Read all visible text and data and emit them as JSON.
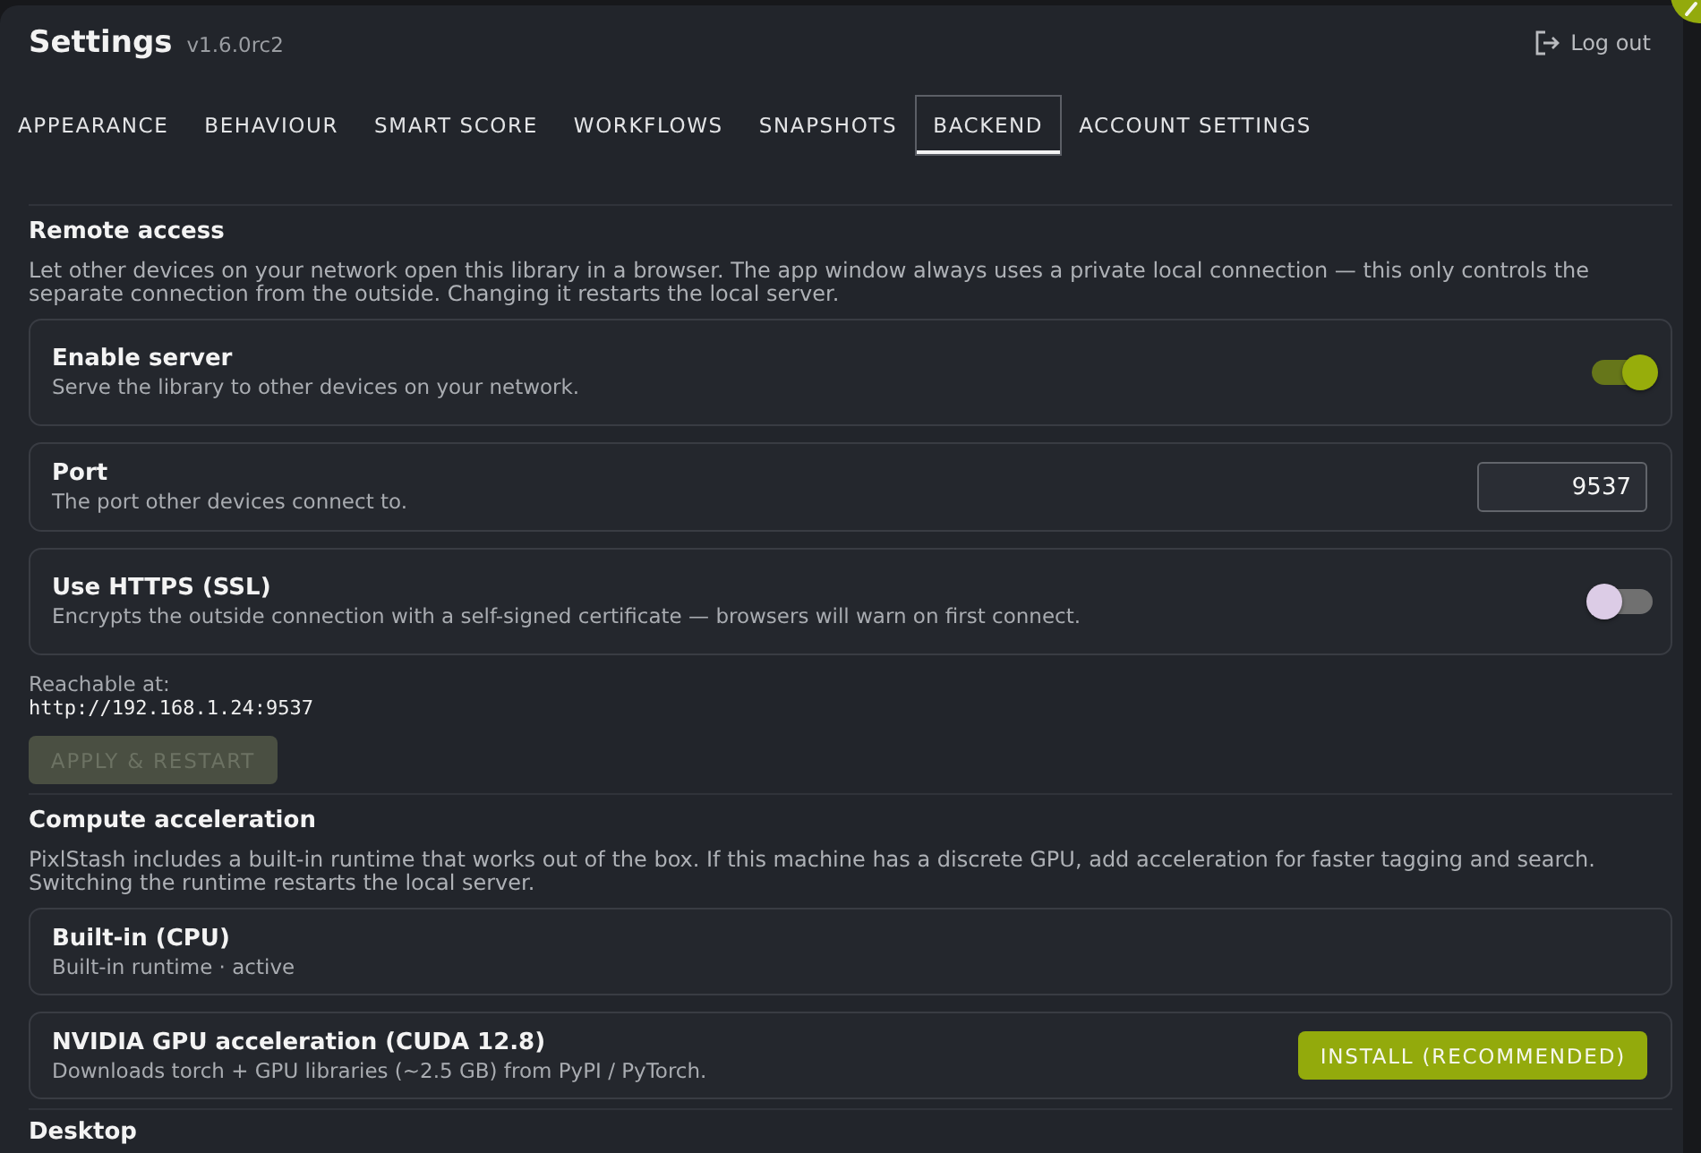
{
  "header": {
    "title": "Settings",
    "version": "v1.6.0rc2",
    "logout": "Log out"
  },
  "tabs": [
    {
      "label": "APPEARANCE",
      "selected": false
    },
    {
      "label": "BEHAVIOUR",
      "selected": false
    },
    {
      "label": "SMART SCORE",
      "selected": false
    },
    {
      "label": "WORKFLOWS",
      "selected": false
    },
    {
      "label": "SNAPSHOTS",
      "selected": false
    },
    {
      "label": "BACKEND",
      "selected": true
    },
    {
      "label": "ACCOUNT SETTINGS",
      "selected": false
    }
  ],
  "sections": [
    {
      "title": "Remote access",
      "description": "Let other devices on your network open this library in a browser. The app window always uses a private local connection — this only controls the separate connection from the outside. Changing it restarts the local server.",
      "settings": [
        {
          "kind": "toggle",
          "label": "Enable server",
          "hint": "Serve the library to other devices on your network.",
          "on": true
        },
        {
          "kind": "number",
          "label": "Port",
          "hint": "The port other devices connect to.",
          "value": "9537"
        },
        {
          "kind": "toggle",
          "label": "Use HTTPS (SSL)",
          "hint": "Encrypts the outside connection with a self-signed certificate — browsers will warn on first connect.",
          "on": false
        }
      ],
      "address_label": "Reachable at:",
      "address": "http://192.168.1.24:9537",
      "button": {
        "label": "APPLY & RESTART",
        "disabled": true
      }
    },
    {
      "title": "Compute acceleration",
      "description": "PixlStash includes a built-in runtime that works out of the box. If this machine has a discrete GPU, add acceleration for faster tagging and search. Switching the runtime restarts the local server.",
      "settings": [
        {
          "kind": "info",
          "label": "Built-in (CPU)",
          "hint": "Built-in runtime · active"
        },
        {
          "kind": "action",
          "label": "NVIDIA GPU acceleration (CUDA 12.8)",
          "hint": "Downloads torch + GPU libraries (~2.5 GB) from PyPI / PyTorch.",
          "button": "INSTALL (RECOMMENDED)"
        }
      ]
    },
    {
      "title": "Desktop"
    }
  ]
}
